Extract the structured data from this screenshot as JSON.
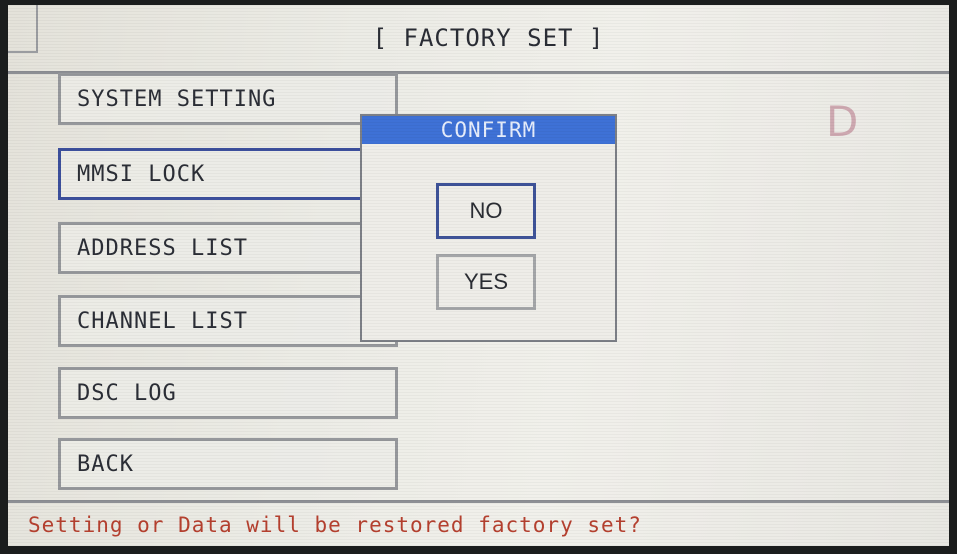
{
  "header": {
    "title": "[ FACTORY SET ]"
  },
  "menu": {
    "items": [
      {
        "label": "SYSTEM SETTING"
      },
      {
        "label": "MMSI LOCK"
      },
      {
        "label": "ADDRESS LIST"
      },
      {
        "label": "CHANNEL LIST"
      },
      {
        "label": "DSC LOG"
      },
      {
        "label": "BACK"
      }
    ],
    "selected_index": 1
  },
  "dialog": {
    "title": "CONFIRM",
    "no_label": "NO",
    "yes_label": "YES",
    "focused": "NO"
  },
  "indicator": {
    "glyph": "D"
  },
  "status": {
    "message": "Setting or Data will be restored factory set?"
  },
  "colors": {
    "dialog_header": "#3e71d6",
    "status_text": "#b5402f",
    "selected_border": "#3c4f9c"
  }
}
